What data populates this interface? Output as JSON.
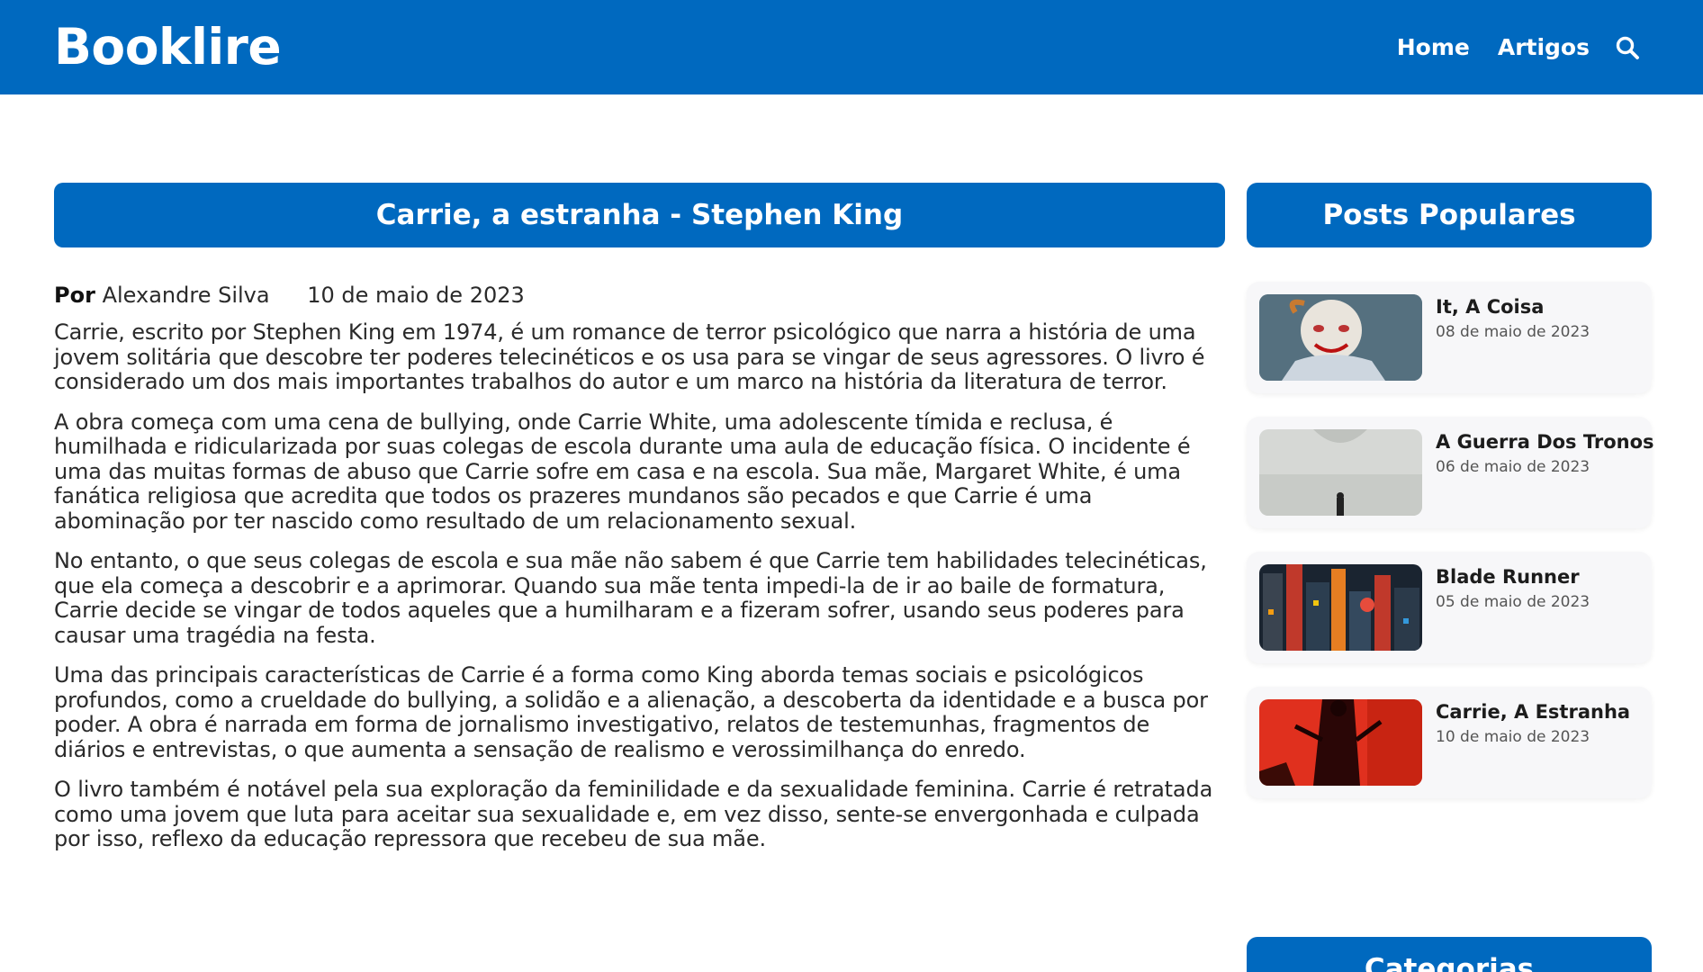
{
  "header": {
    "brand": "Booklire",
    "nav": {
      "home": "Home",
      "articles": "Artigos"
    },
    "search_icon": "search-icon"
  },
  "article": {
    "title": "Carrie, a estranha - Stephen King",
    "by_label": "Por",
    "author": "Alexandre Silva",
    "date": "10 de maio de 2023",
    "paragraphs": [
      "Carrie, escrito por Stephen King em 1974, é um romance de terror psicológico que narra a história de uma jovem solitária que descobre ter poderes telecinéticos e os usa para se vingar de seus agressores. O livro é considerado um dos mais importantes trabalhos do autor e um marco na história da literatura de terror.",
      "A obra começa com uma cena de bullying, onde Carrie White, uma adolescente tímida e reclusa, é humilhada e ridicularizada por suas colegas de escola durante uma aula de educação física. O incidente é uma das muitas formas de abuso que Carrie sofre em casa e na escola. Sua mãe, Margaret White, é uma fanática religiosa que acredita que todos os prazeres mundanos são pecados e que Carrie é uma abominação por ter nascido como resultado de um relacionamento sexual.",
      "No entanto, o que seus colegas de escola e sua mãe não sabem é que Carrie tem habilidades telecinéticas, que ela começa a descobrir e a aprimorar. Quando sua mãe tenta impedi-la de ir ao baile de formatura, Carrie decide se vingar de todos aqueles que a humilharam e a fizeram sofrer, usando seus poderes para causar uma tragédia na festa.",
      "Uma das principais características de Carrie é a forma como King aborda temas sociais e psicológicos profundos, como a crueldade do bullying, a solidão e a alienação, a descoberta da identidade e a busca por poder. A obra é narrada em forma de jornalismo investigativo, relatos de testemunhas, fragmentos de diários e entrevistas, o que aumenta a sensação de realismo e verossimilhança do enredo.",
      "O livro também é notável pela sua exploração da feminilidade e da sexualidade feminina. Carrie é retratada como uma jovem que luta para aceitar sua sexualidade e, em vez disso, sente-se envergonhada e culpada por isso, reflexo da educação repressora que recebeu de sua mãe."
    ]
  },
  "sidebar": {
    "popular_title": "Posts Populares",
    "posts": [
      {
        "title": "It, A Coisa",
        "date": "08 de maio de 2023"
      },
      {
        "title": "A Guerra Dos Tronos",
        "date": "06 de maio de 2023"
      },
      {
        "title": "Blade Runner",
        "date": "05 de maio de 2023"
      },
      {
        "title": "Carrie, A Estranha",
        "date": "10 de maio de 2023"
      }
    ],
    "categories_title": "Categorias"
  },
  "colors": {
    "primary": "#0069bf",
    "card_bg": "#f7f7f9",
    "text": "#2a2a2a"
  }
}
